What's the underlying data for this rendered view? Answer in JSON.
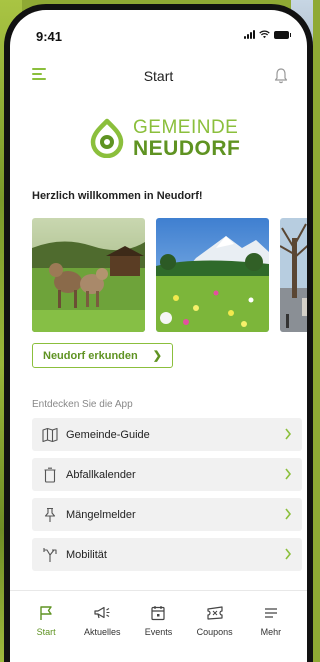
{
  "status_bar": {
    "time": "9:41"
  },
  "header": {
    "title": "Start"
  },
  "logo": {
    "line1": "GEMEINDE",
    "line2": "NEUDORF"
  },
  "welcome_text": "Herzlich willkommen in Neudorf!",
  "explore_button": {
    "label": "Neudorf erkunden"
  },
  "discover": {
    "title": "Entdecken Sie die App",
    "items": [
      {
        "label": "Gemeinde-Guide",
        "icon": "map-icon"
      },
      {
        "label": "Abfallkalender",
        "icon": "trash-icon"
      },
      {
        "label": "Mängelmelder",
        "icon": "pin-icon"
      },
      {
        "label": "Mobilität",
        "icon": "route-icon"
      }
    ]
  },
  "tabbar": {
    "tabs": [
      {
        "label": "Start",
        "icon": "flag-icon",
        "active": true
      },
      {
        "label": "Aktuelles",
        "icon": "megaphone-icon",
        "active": false
      },
      {
        "label": "Events",
        "icon": "calendar-icon",
        "active": false
      },
      {
        "label": "Coupons",
        "icon": "ticket-icon",
        "active": false
      },
      {
        "label": "Mehr",
        "icon": "menu-icon",
        "active": false
      }
    ]
  },
  "colors": {
    "accent": "#8bbf3c",
    "accent_dark": "#5f9322",
    "list_bg": "#f1f1f1"
  }
}
